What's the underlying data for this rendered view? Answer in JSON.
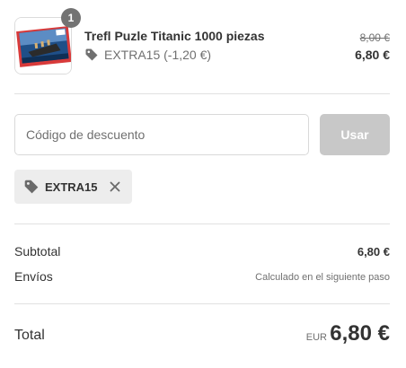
{
  "line_item": {
    "quantity": "1",
    "name": "Trefl Puzle Titanic 1000 piezas",
    "discount_text": "EXTRA15 (-1,20 €)",
    "original_price": "8,00 €",
    "price": "6,80 €",
    "thumbnail_icon": "puzzle-box-image"
  },
  "discount_form": {
    "placeholder": "Código de descuento",
    "value": "",
    "apply_label": "Usar"
  },
  "applied_code": {
    "code": "EXTRA15",
    "icon": "tag-icon",
    "remove_icon": "close-icon"
  },
  "summary": {
    "subtotal_label": "Subtotal",
    "subtotal_value": "6,80 €",
    "shipping_label": "Envíos",
    "shipping_value": "Calculado en el siguiente paso"
  },
  "total": {
    "label": "Total",
    "currency": "EUR",
    "value": "6,80 €"
  },
  "colors": {
    "apply_button_disabled": "#c8c8c8",
    "chip_background": "#ededed",
    "badge": "#737373"
  }
}
